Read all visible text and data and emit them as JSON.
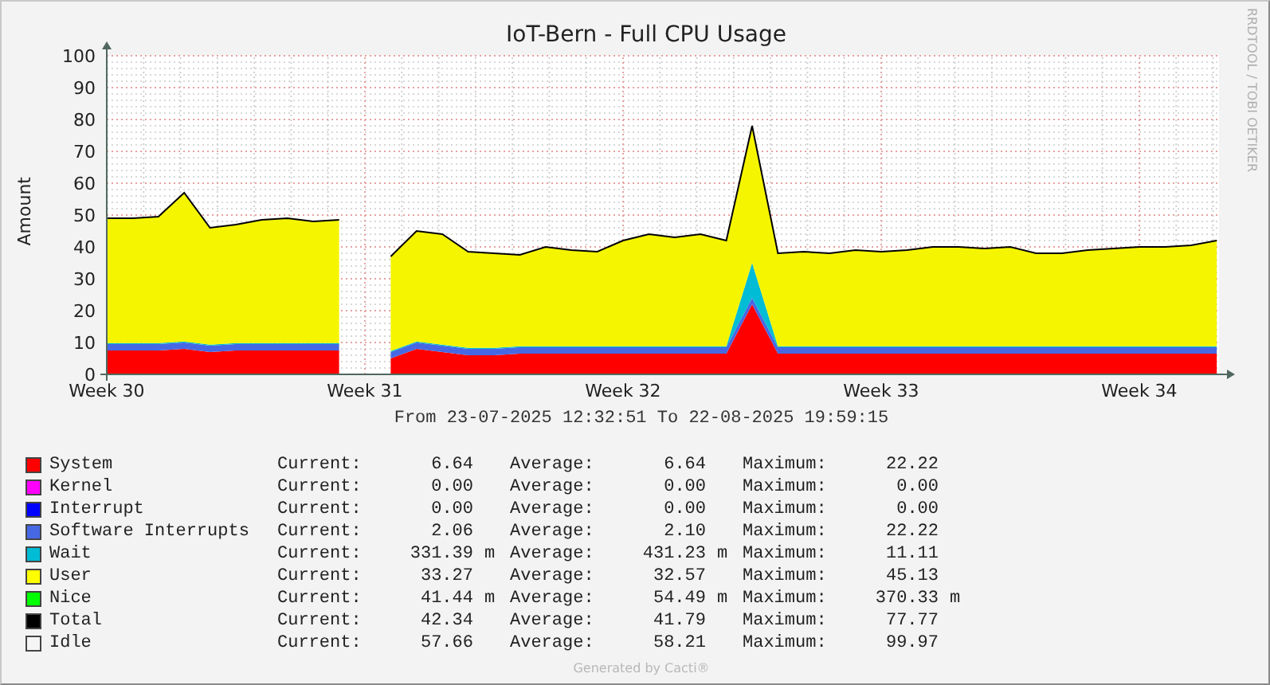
{
  "chart": {
    "credit": "RRDTOOL / TOBI OETIKER",
    "chart_data": {
      "type": "area",
      "title": "IoT-Bern - Full CPU Usage",
      "ylabel": "Amount",
      "stacked": true,
      "grid": true,
      "ylim": [
        0,
        100
      ],
      "yticks": [
        0,
        10,
        20,
        30,
        40,
        50,
        60,
        70,
        80,
        90,
        100
      ],
      "categories": [
        "Week 30",
        null,
        null,
        null,
        null,
        null,
        null,
        null,
        null,
        null,
        "Week 31",
        null,
        null,
        null,
        null,
        null,
        null,
        null,
        null,
        null,
        "Week 32",
        null,
        null,
        null,
        null,
        null,
        null,
        null,
        null,
        null,
        "Week 33",
        null,
        null,
        null,
        null,
        null,
        null,
        null,
        null,
        null,
        "Week 34",
        null,
        null,
        null
      ],
      "series": [
        {
          "color": "#ff0000",
          "values": [
            7.5,
            7.5,
            7.5,
            8,
            7,
            7.5,
            7.5,
            7.5,
            7.5,
            7.5,
            null,
            5,
            8,
            7,
            6,
            6,
            6.5,
            6.5,
            6.5,
            6.5,
            6.5,
            6.5,
            6.5,
            6.5,
            6.5,
            22,
            6.5,
            6.5,
            6.5,
            6.5,
            6.5,
            6.5,
            6.5,
            6.5,
            6.5,
            6.5,
            6.5,
            6.5,
            6.5,
            6.5,
            6.5,
            6.5,
            6.5,
            6.5
          ]
        },
        {
          "color": "#4668e4",
          "values": [
            2,
            2,
            2,
            2,
            2,
            2,
            2,
            2,
            2,
            2,
            null,
            2,
            2,
            2,
            2,
            2,
            2,
            2,
            2,
            2,
            2,
            2,
            2,
            2,
            2,
            2,
            2,
            2,
            2,
            2,
            2,
            2,
            2,
            2,
            2,
            2,
            2,
            2,
            2,
            2,
            2,
            2,
            2,
            2
          ]
        },
        {
          "color": "#00bcd4",
          "values": [
            0.3,
            0.3,
            0.3,
            0.3,
            0.3,
            0.3,
            0.3,
            0.3,
            0.3,
            0.3,
            null,
            0.3,
            0.3,
            0.3,
            0.3,
            0.3,
            0.3,
            0.3,
            0.3,
            0.3,
            0.3,
            0.3,
            0.3,
            0.3,
            0.3,
            11,
            0.3,
            0.3,
            0.3,
            0.3,
            0.3,
            0.3,
            0.3,
            0.3,
            0.3,
            0.3,
            0.3,
            0.3,
            0.3,
            0.3,
            0.3,
            0.3,
            0.3,
            0.3
          ]
        },
        {
          "color": "#f5f500",
          "values": [
            39.2,
            39.2,
            39.7,
            46.7,
            36.7,
            37.2,
            38.7,
            39.2,
            38.2,
            38.7,
            null,
            29.7,
            34.7,
            34.7,
            30.2,
            29.7,
            28.7,
            31.2,
            30.2,
            29.7,
            33.2,
            35.2,
            34.2,
            35.2,
            33.2,
            43,
            29.2,
            29.7,
            29.2,
            30.2,
            29.7,
            30.2,
            31.2,
            31.2,
            30.7,
            31.2,
            29.2,
            29.2,
            30.2,
            30.7,
            31.2,
            31.2,
            31.7,
            33.2
          ]
        }
      ]
    }
  },
  "time_range": "From 23-07-2025 12:32:51 To 22-08-2025 19:59:15",
  "legend": [
    {
      "name": "System",
      "color": "#ff0000",
      "current_label": "Current:",
      "current": "6.64",
      "average_label": "Average:",
      "average": "6.64",
      "maximum_label": "Maximum:",
      "maximum": "22.22"
    },
    {
      "name": "Kernel",
      "color": "#ff00ff",
      "current_label": "Current:",
      "current": "0.00",
      "average_label": "Average:",
      "average": "0.00",
      "maximum_label": "Maximum:",
      "maximum": "0.00"
    },
    {
      "name": "Interrupt",
      "color": "#0000ff",
      "current_label": "Current:",
      "current": "0.00",
      "average_label": "Average:",
      "average": "0.00",
      "maximum_label": "Maximum:",
      "maximum": "0.00"
    },
    {
      "name": "Software Interrupts",
      "color": "#4668e4",
      "current_label": "Current:",
      "current": "2.06",
      "average_label": "Average:",
      "average": "2.10",
      "maximum_label": "Maximum:",
      "maximum": "22.22"
    },
    {
      "name": "Wait",
      "color": "#00bcd4",
      "current_label": "Current:",
      "current": "331.39",
      "current_unit": "m",
      "average_label": "Average:",
      "average": "431.23",
      "average_unit": "m",
      "maximum_label": "Maximum:",
      "maximum": "11.11"
    },
    {
      "name": "User",
      "color": "#ffff00",
      "current_label": "Current:",
      "current": "33.27",
      "average_label": "Average:",
      "average": "32.57",
      "maximum_label": "Maximum:",
      "maximum": "45.13"
    },
    {
      "name": "Nice",
      "color": "#00ff00",
      "current_label": "Current:",
      "current": "41.44",
      "current_unit": "m",
      "average_label": "Average:",
      "average": "54.49",
      "average_unit": "m",
      "maximum_label": "Maximum:",
      "maximum": "370.33",
      "maximum_unit": "m"
    },
    {
      "name": "Total",
      "color": "#000000",
      "current_label": "Current:",
      "current": "42.34",
      "average_label": "Average:",
      "average": "41.79",
      "maximum_label": "Maximum:",
      "maximum": "77.77"
    },
    {
      "name": "Idle",
      "color": "#f5f5f5",
      "current_label": "Current:",
      "current": "57.66",
      "average_label": "Average:",
      "average": "58.21",
      "maximum_label": "Maximum:",
      "maximum": "99.97"
    }
  ],
  "footer": "Generated by Cacti®"
}
